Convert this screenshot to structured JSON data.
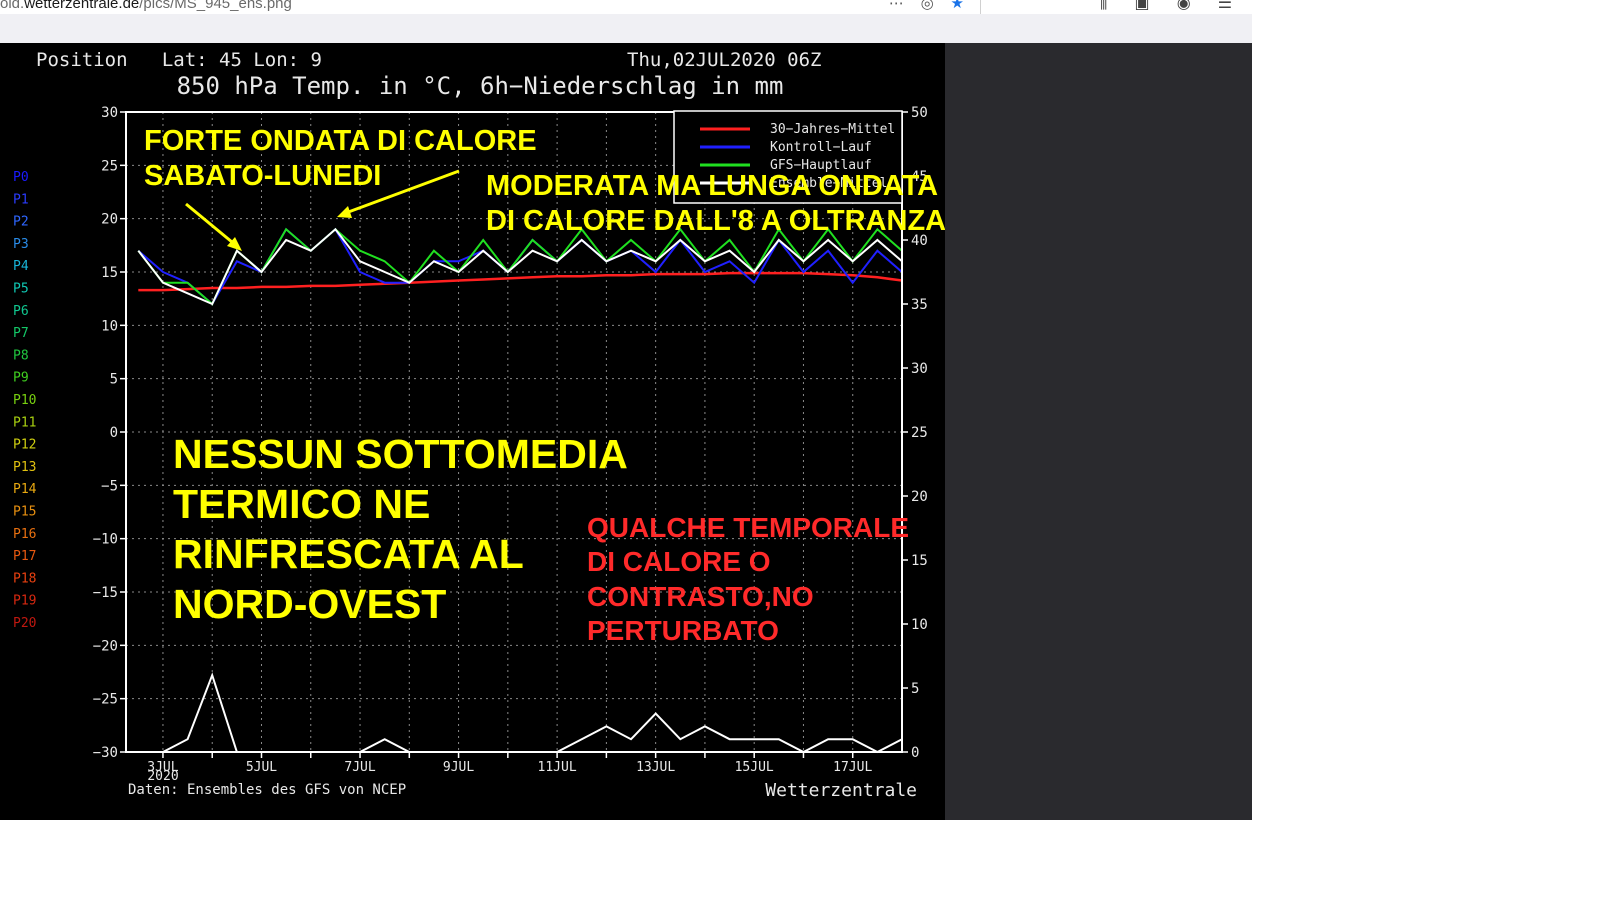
{
  "browser": {
    "url_prefix": "old.",
    "url_host": "wetterzentrale.de",
    "url_path": "/pics/MS_945_ens.png",
    "icon_more": "more-icon",
    "icon_pocket": "pocket-icon",
    "icon_bookmark": "bookmark-star-icon",
    "icon_library": "library-icon",
    "icon_sidebar": "sidebar-icon",
    "icon_account": "account-icon",
    "icon_menu": "hamburger-menu-icon"
  },
  "chart_data": {
    "type": "line",
    "header_position": "Position   Lat: 45 Lon: 9",
    "header_date": "Thu,02JUL2020 06Z",
    "title": "850 hPa Temp. in °C, 6h−Niederschlag in mm",
    "footer_source": "Daten: Ensembles des GFS von NCEP",
    "footer_brand": "Wetterzentrale",
    "x_ticks": [
      "3JUL",
      "5JUL",
      "7JUL",
      "9JUL",
      "11JUL",
      "13JUL",
      "15JUL",
      "17JUL"
    ],
    "x_year": "2020",
    "xlim_days": [
      2.25,
      18
    ],
    "y_left": {
      "ticks": [
        "30",
        "25",
        "20",
        "15",
        "10",
        "5",
        "0",
        "−5",
        "−10",
        "−15",
        "−20",
        "−25",
        "−30"
      ],
      "ylim": [
        -30,
        30
      ]
    },
    "y_right": {
      "ticks": [
        "50",
        "45",
        "40",
        "35",
        "30",
        "25",
        "20",
        "15",
        "10",
        "5",
        "0"
      ],
      "ylim": [
        0,
        50
      ]
    },
    "grid": true,
    "legend_position": "top-right",
    "legend": [
      {
        "label": "30−Jahres−Mittel",
        "color": "#ff2020"
      },
      {
        "label": "Kontroll−Lauf",
        "color": "#2020ff"
      },
      {
        "label": "GFS−Hauptlauf",
        "color": "#20e020"
      },
      {
        "label": "Ensemble−Mittel",
        "color": "#ffffff"
      }
    ],
    "members": [
      {
        "label": "P0",
        "color": "#1a1aff"
      },
      {
        "label": "P1",
        "color": "#2a3cff"
      },
      {
        "label": "P2",
        "color": "#2e66ff"
      },
      {
        "label": "P3",
        "color": "#2a8ce8"
      },
      {
        "label": "P4",
        "color": "#18b4d8"
      },
      {
        "label": "P5",
        "color": "#10c8b4"
      },
      {
        "label": "P6",
        "color": "#10c890"
      },
      {
        "label": "P7",
        "color": "#14c868"
      },
      {
        "label": "P8",
        "color": "#20c840"
      },
      {
        "label": "P9",
        "color": "#40d020"
      },
      {
        "label": "P10",
        "color": "#78d010"
      },
      {
        "label": "P11",
        "color": "#a8d010"
      },
      {
        "label": "P12",
        "color": "#d0d010"
      },
      {
        "label": "P13",
        "color": "#e0c010"
      },
      {
        "label": "P14",
        "color": "#e8a810"
      },
      {
        "label": "P15",
        "color": "#e89010"
      },
      {
        "label": "P16",
        "color": "#e87010"
      },
      {
        "label": "P17",
        "color": "#e85810"
      },
      {
        "label": "P18",
        "color": "#e84010"
      },
      {
        "label": "P19",
        "color": "#d82810"
      },
      {
        "label": "P20",
        "color": "#c01810"
      }
    ],
    "series_x_days": [
      2.5,
      3,
      3.5,
      4,
      4.5,
      5,
      5.5,
      6,
      6.5,
      7,
      7.5,
      8,
      8.5,
      9,
      9.5,
      10,
      10.5,
      11,
      11.5,
      12,
      12.5,
      13,
      13.5,
      14,
      14.5,
      15,
      15.5,
      16,
      16.5,
      17,
      17.5,
      18
    ],
    "series": [
      {
        "name": "30−Jahres−Mittel",
        "color": "#ff2020",
        "y": [
          13.3,
          13.3,
          13.4,
          13.5,
          13.5,
          13.6,
          13.6,
          13.7,
          13.7,
          13.8,
          13.9,
          14.0,
          14.1,
          14.2,
          14.3,
          14.4,
          14.5,
          14.6,
          14.6,
          14.7,
          14.7,
          14.8,
          14.8,
          14.8,
          14.9,
          14.9,
          14.9,
          14.9,
          14.8,
          14.7,
          14.5,
          14.2
        ]
      },
      {
        "name": "Kontroll−Lauf",
        "color": "#2020ff",
        "y": [
          17,
          15,
          14,
          12,
          16,
          15,
          19,
          17,
          19,
          15,
          14,
          14,
          16,
          16,
          17,
          15,
          18,
          16,
          18,
          16,
          17,
          15,
          18,
          15,
          16,
          14,
          18,
          15,
          17,
          14,
          17,
          15
        ]
      },
      {
        "name": "GFS−Hauptlauf",
        "color": "#20e020",
        "y": [
          17,
          14,
          14,
          12,
          17,
          15,
          19,
          17,
          19,
          17,
          16,
          14,
          17,
          15,
          18,
          15,
          18,
          16,
          19,
          16,
          18,
          16,
          19,
          16,
          18,
          15,
          19,
          16,
          19,
          16,
          19,
          17
        ]
      },
      {
        "name": "Ensemble−Mittel",
        "color": "#ffffff",
        "y": [
          17,
          14,
          13,
          12,
          17,
          15,
          18,
          17,
          19,
          16,
          15,
          14,
          16,
          15,
          17,
          15,
          17,
          16,
          18,
          16,
          17,
          16,
          18,
          16,
          17,
          15,
          18,
          16,
          18,
          16,
          18,
          16
        ]
      }
    ],
    "precip_series": [
      {
        "name": "Ensemble−Mittel",
        "color": "#ffffff",
        "y": [
          0,
          0,
          1,
          6,
          0,
          0,
          0,
          0,
          0,
          0,
          1,
          0,
          0,
          0,
          0,
          0,
          0,
          0,
          1,
          2,
          1,
          3,
          1,
          2,
          1,
          1,
          1,
          0,
          1,
          1,
          0,
          1
        ]
      }
    ],
    "annotations": [
      {
        "text": "FORTE ONDATA DI CALORE",
        "color": "#ffff00"
      },
      {
        "text": "SABATO-LUNEDI",
        "color": "#ffff00"
      },
      {
        "text": "MODERATA MA LUNGA ONDATA",
        "color": "#ffff00"
      },
      {
        "text": "DI CALORE DALL'8 A OLTRANZA",
        "color": "#ffff00"
      },
      {
        "text": "NESSUN SOTTOMEDIA",
        "color": "#ffff00"
      },
      {
        "text": "TERMICO NE",
        "color": "#ffff00"
      },
      {
        "text": "RINFRESCATA AL",
        "color": "#ffff00"
      },
      {
        "text": "NORD-OVEST",
        "color": "#ffff00"
      },
      {
        "text": "QUALCHE TEMPORALE",
        "color": "#ff2a2a"
      },
      {
        "text": "DI CALORE O",
        "color": "#ff2a2a"
      },
      {
        "text": "CONTRASTO,NO",
        "color": "#ff2a2a"
      },
      {
        "text": "PERTURBATO",
        "color": "#ff2a2a"
      }
    ]
  }
}
